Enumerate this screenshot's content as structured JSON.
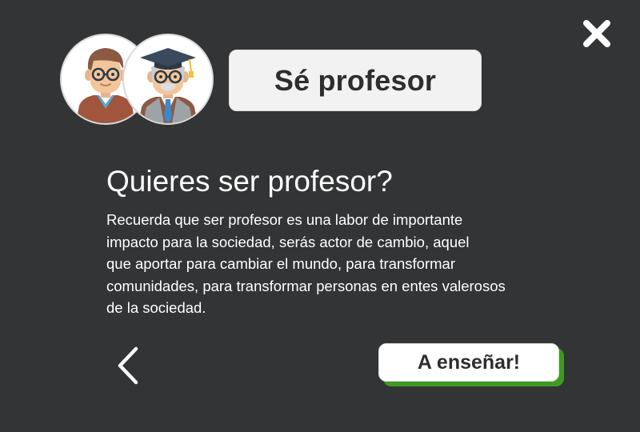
{
  "dialog": {
    "title_badge": "Sé profesor",
    "heading": "Quieres ser profesor?",
    "body": "Recuerda que ser profesor es una labor de importante\nimpacto para la sociedad, serás actor de cambio, aquel\nque aportar para cambiar el mundo, para transformar\ncomunidades, para transformar personas en entes valerosos\nde la sociedad.",
    "cta_label": "A enseñar!"
  },
  "icons": {
    "close": "close-icon",
    "back": "chevron-left-icon",
    "avatar_student": "student-avatar-icon",
    "avatar_teacher": "professor-avatar-icon"
  },
  "colors": {
    "background": "#333435",
    "cta_shadow": "#3d9a21",
    "pill_background": "#f2f2f2",
    "text_light": "#ffffff",
    "text_dark": "#2e2e2e"
  }
}
